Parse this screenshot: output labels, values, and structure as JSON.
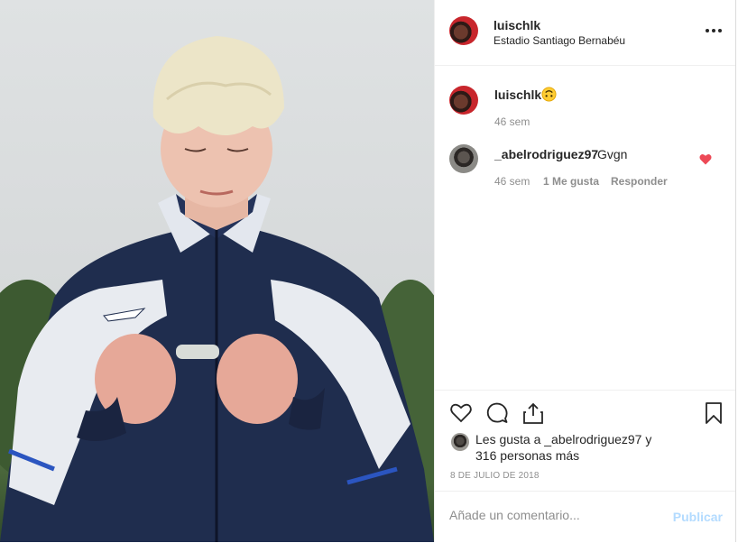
{
  "post": {
    "author": "luischlk",
    "location": "Estadio Santiago Bernabéu",
    "caption_emoji": "upside-down-face-emoji"
  },
  "comments": [
    {
      "user": "luischlk",
      "time": "46 sem"
    },
    {
      "user": "_abelrodriguez97",
      "text": "Gvgn",
      "time": "46 sem",
      "likes": "1 Me gusta",
      "reply": "Responder"
    }
  ],
  "likes": {
    "line1": "Les gusta a _abelrodriguez97 y",
    "line2": "316 personas más"
  },
  "date": "8 DE JULIO DE 2018",
  "comment_box": {
    "placeholder": "Añade un comentario...",
    "publish": "Publicar"
  },
  "colors": {
    "heart": "#ed4956",
    "publish_disabled": "#b3dbff",
    "meta": "#8e8e8e"
  },
  "icons": [
    "more-icon",
    "like-icon",
    "comment-icon",
    "share-icon",
    "save-icon",
    "heart-icon"
  ]
}
